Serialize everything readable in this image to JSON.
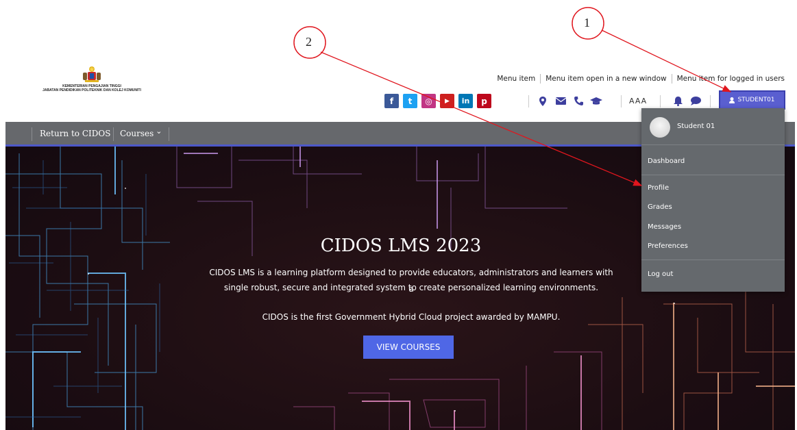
{
  "ministry": {
    "line1": "KEMENTERIAN PENGAJIAN TINGGI",
    "line2": "JABATAN PENDIDIKAN POLITEKNIK DAN KOLEJ KOMUNITI"
  },
  "top_menu": [
    {
      "label": "Menu item"
    },
    {
      "label": "Menu item open in a new window"
    },
    {
      "label": "Menu item for logged in users"
    }
  ],
  "social_icons": [
    {
      "name": "facebook-icon",
      "glyph": "f",
      "color": "#3b5998"
    },
    {
      "name": "twitter-icon",
      "glyph": "t",
      "color": "#1da1f2"
    },
    {
      "name": "instagram-icon",
      "glyph": "◎",
      "color": "#c13584"
    },
    {
      "name": "youtube-icon",
      "glyph": "▶",
      "color": "#cd201f"
    },
    {
      "name": "linkedin-icon",
      "glyph": "in",
      "color": "#0077b5"
    },
    {
      "name": "pinterest-icon",
      "glyph": "p",
      "color": "#bd081c"
    }
  ],
  "font_size_label": "AAA",
  "user_button": {
    "label": "STUDENT01"
  },
  "nav": {
    "return_label": "Return to CIDOS",
    "courses_label": "Courses",
    "courses_chevron": "⌄"
  },
  "hero": {
    "title": "CIDOS LMS 2023",
    "line1": "CIDOS LMS is a learning platform designed to provide educators, administrators and learners with a",
    "line2": "single robust, secure and integrated system to create personalized learning environments.",
    "line3": "CIDOS is the first Government Hybrid Cloud project awarded by MAMPU.",
    "button_label": "VIEW COURSES"
  },
  "dropdown": {
    "user_name": "Student 01",
    "items": [
      {
        "label": "Dashboard"
      },
      {
        "label": "Profile"
      },
      {
        "label": "Grades"
      },
      {
        "label": "Messages"
      },
      {
        "label": "Preferences"
      },
      {
        "label": "Log out"
      }
    ]
  },
  "annotations": [
    {
      "number": "1"
    },
    {
      "number": "2"
    }
  ],
  "colors": {
    "accent": "#4f67e6",
    "nav_bg": "#66686c",
    "dropdown_bg": "#65696d",
    "annotation_red": "#e0161e"
  }
}
